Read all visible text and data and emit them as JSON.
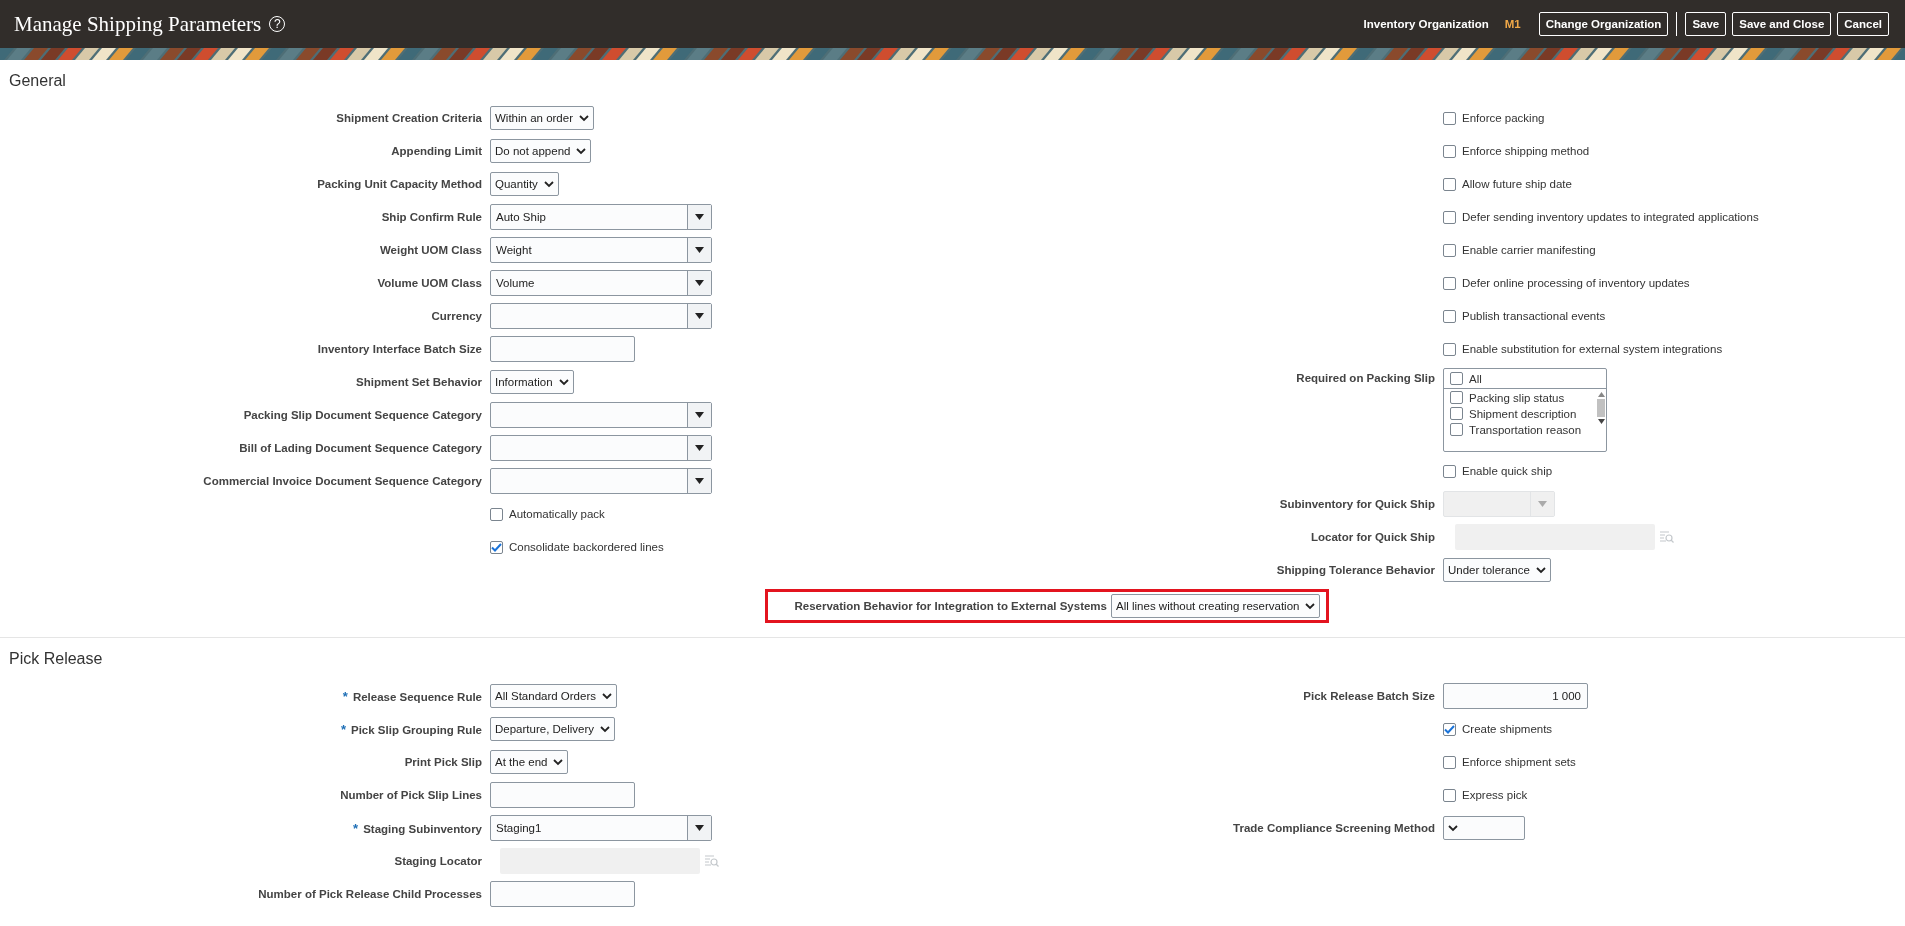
{
  "header": {
    "title": "Manage Shipping Parameters",
    "help": "?",
    "org_label": "Inventory Organization",
    "org_value": "M1",
    "button_groups": [
      [
        "Change Organization"
      ],
      [
        "Save",
        "Save and Close",
        "Cancel"
      ]
    ]
  },
  "sections": [
    {
      "title": "General",
      "columns": [
        [
          {
            "kind": "choice",
            "label": "Shipment Creation Criteria",
            "value": "Within an order"
          },
          {
            "kind": "choice",
            "label": "Appending Limit",
            "value": "Do not append"
          },
          {
            "kind": "choice",
            "label": "Packing Unit Capacity Method",
            "value": "Quantity"
          },
          {
            "kind": "combo",
            "label": "Ship Confirm Rule",
            "value": "Auto Ship",
            "disabled": false
          },
          {
            "kind": "combo",
            "label": "Weight UOM Class",
            "value": "Weight",
            "disabled": false
          },
          {
            "kind": "combo",
            "label": "Volume UOM Class",
            "value": "Volume",
            "disabled": false
          },
          {
            "kind": "combo",
            "label": "Currency",
            "disabled": false
          },
          {
            "kind": "text",
            "label": "Inventory Interface Batch Size"
          },
          {
            "kind": "choice",
            "label": "Shipment Set Behavior",
            "value": "Information"
          },
          {
            "kind": "combo",
            "label": "Packing Slip Document Sequence Category",
            "disabled": false
          },
          {
            "kind": "combo",
            "label": "Bill of Lading Document Sequence Category",
            "disabled": false
          },
          {
            "kind": "combo",
            "label": "Commercial Invoice Document Sequence Category",
            "disabled": false
          },
          {
            "kind": "checkbox",
            "label": "Automatically pack",
            "checked": false
          },
          {
            "kind": "checkbox",
            "label": "Consolidate backordered lines",
            "checked": true
          }
        ],
        [
          {
            "kind": "checkbox",
            "label": "Enforce packing",
            "checked": false
          },
          {
            "kind": "checkbox",
            "label": "Enforce shipping method",
            "checked": false
          },
          {
            "kind": "checkbox",
            "label": "Allow future ship date",
            "checked": false
          },
          {
            "kind": "checkbox",
            "label": "Defer sending inventory updates to integrated applications",
            "checked": false
          },
          {
            "kind": "checkbox",
            "label": "Enable carrier manifesting",
            "checked": false
          },
          {
            "kind": "checkbox",
            "label": "Defer online processing of inventory updates",
            "checked": false
          },
          {
            "kind": "checkbox",
            "label": "Publish transactional events",
            "checked": false
          },
          {
            "kind": "checkbox",
            "label": "Enable substitution for external system integrations",
            "checked": false
          },
          {
            "kind": "checklist",
            "label": "Required on Packing Slip",
            "all": {
              "label": "All",
              "checked": false
            },
            "items": [
              {
                "label": "Packing slip status",
                "checked": false
              },
              {
                "label": "Shipment description",
                "checked": false
              },
              {
                "label": "Transportation reason",
                "checked": false
              }
            ]
          },
          {
            "kind": "checkbox",
            "label": "Enable quick ship",
            "checked": false
          },
          {
            "kind": "combo",
            "label": "Subinventory for Quick Ship",
            "disabled": true
          },
          {
            "kind": "lookup",
            "label": "Locator for Quick Ship"
          },
          {
            "kind": "choice",
            "label": "Shipping Tolerance Behavior",
            "value": "Under tolerance"
          },
          {
            "kind": "choice",
            "label": "Reservation Behavior for Integration to External Systems",
            "value": "All lines without creating reservation",
            "highlighted": true
          }
        ]
      ]
    },
    {
      "title": "Pick Release",
      "columns": [
        [
          {
            "kind": "choice",
            "label": "Release Sequence Rule",
            "value": "All Standard Orders",
            "required_mark": "*"
          },
          {
            "kind": "choice",
            "label": "Pick Slip Grouping Rule",
            "value": "Departure, Delivery",
            "required_mark": "*"
          },
          {
            "kind": "choice",
            "label": "Print Pick Slip",
            "value": "At the end"
          },
          {
            "kind": "text",
            "label": "Number of Pick Slip Lines"
          },
          {
            "kind": "combo",
            "label": "Staging Subinventory",
            "value": "Staging1",
            "required_mark": "*",
            "disabled": false
          },
          {
            "kind": "lookup",
            "label": "Staging Locator"
          },
          {
            "kind": "text",
            "label": "Number of Pick Release Child Processes"
          }
        ],
        [
          {
            "kind": "number",
            "label": "Pick Release Batch Size",
            "value": "1 000"
          },
          {
            "kind": "checkbox",
            "label": "Create shipments",
            "checked": true
          },
          {
            "kind": "checkbox",
            "label": "Enforce shipment sets",
            "checked": false
          },
          {
            "kind": "checkbox",
            "label": "Express pick",
            "checked": false
          },
          {
            "kind": "choice",
            "label": "Trade Compliance Screening Method"
          }
        ]
      ]
    }
  ]
}
